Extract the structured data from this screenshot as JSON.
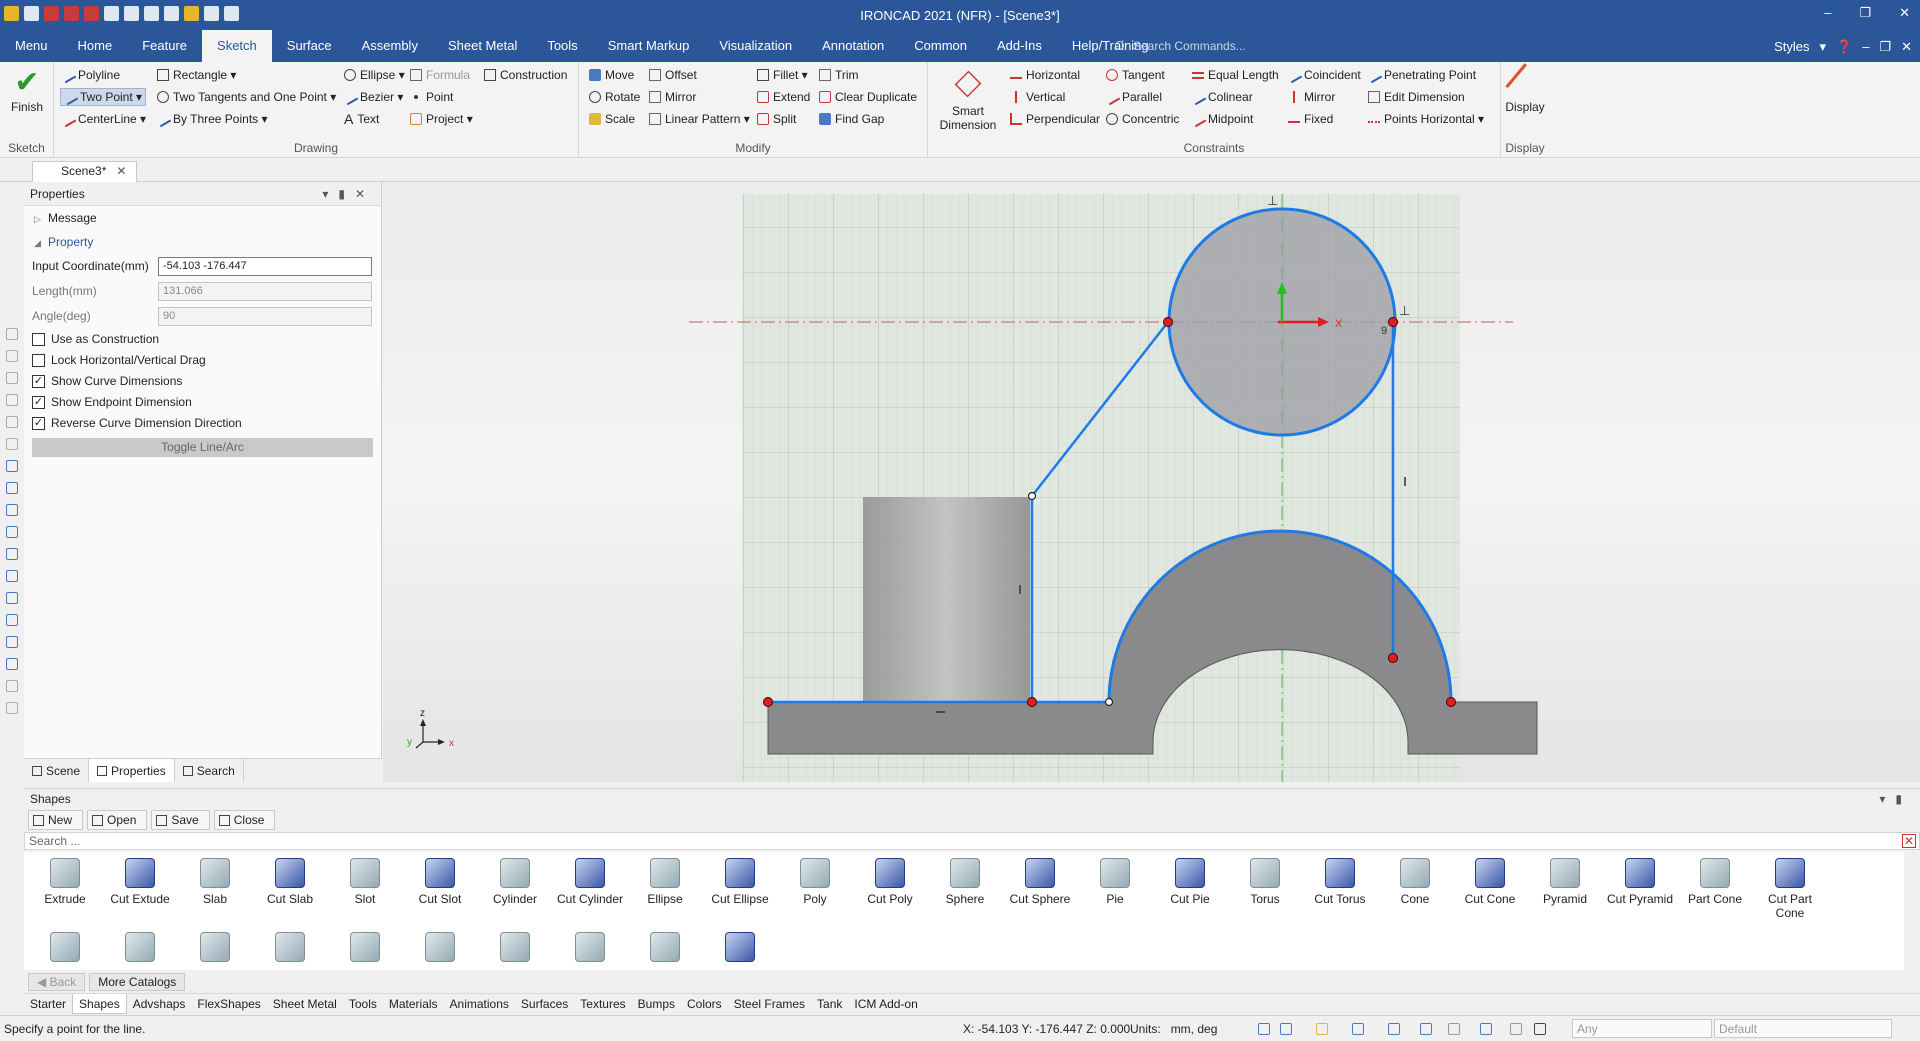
{
  "app": {
    "title": "IRONCAD 2021 (NFR) - [Scene3*]"
  },
  "menu": {
    "tabs": [
      "Menu",
      "Home",
      "Feature",
      "Sketch",
      "Surface",
      "Assembly",
      "Sheet Metal",
      "Tools",
      "Smart Markup",
      "Visualization",
      "Annotation",
      "Common",
      "Add-Ins",
      "Help/Training"
    ],
    "active_tab": "Sketch",
    "search_placeholder": "Search Commands...",
    "styles_label": "Styles"
  },
  "ribbon": {
    "finish_label": "Finish",
    "sketch_group": "Sketch",
    "drawing": {
      "label": "Drawing",
      "polyline": "Polyline",
      "two_point": "Two Point",
      "centerline": "CenterLine",
      "rectangle": "Rectangle",
      "two_tangents": "Two Tangents and One Point",
      "by_three_points": "By Three Points",
      "ellipse": "Ellipse",
      "bezier": "Bezier",
      "text": "Text",
      "formula": "Formula",
      "point": "Point",
      "project": "Project",
      "construction": "Construction"
    },
    "modify": {
      "label": "Modify",
      "move": "Move",
      "rotate": "Rotate",
      "scale": "Scale",
      "offset": "Offset",
      "mirror": "Mirror",
      "linear_pattern": "Linear Pattern",
      "fillet": "Fillet",
      "extend": "Extend",
      "split": "Split",
      "trim": "Trim",
      "clear_duplicate": "Clear Duplicate",
      "find_gap": "Find Gap"
    },
    "smart_dimension": "Smart Dimension",
    "constraints": {
      "label": "Constraints",
      "horizontal": "Horizontal",
      "vertical": "Vertical",
      "perpendicular": "Perpendicular",
      "tangent": "Tangent",
      "parallel": "Parallel",
      "concentric": "Concentric",
      "equal_length": "Equal Length",
      "colinear": "Colinear",
      "midpoint": "Midpoint",
      "coincident": "Coincident",
      "mirror": "Mirror",
      "fixed": "Fixed",
      "penetrating_point": "Penetrating Point",
      "edit_dimension": "Edit Dimension",
      "points_horizontal": "Points Horizontal"
    },
    "display": {
      "label": "Display",
      "button": "Display"
    }
  },
  "doc_tab": "Scene3*",
  "properties": {
    "title": "Properties",
    "message_section": "Message",
    "property_section": "Property",
    "input_coordinate_label": "Input Coordinate(mm)",
    "input_coordinate_value": "-54.103 -176.447",
    "length_label": "Length(mm)",
    "length_value": "131.066",
    "angle_label": "Angle(deg)",
    "angle_value": "90",
    "checkboxes": [
      {
        "label": "Use as Construction",
        "checked": false
      },
      {
        "label": "Lock Horizontal/Vertical Drag",
        "checked": false
      },
      {
        "label": "Show Curve Dimensions",
        "checked": true
      },
      {
        "label": "Show Endpoint Dimension",
        "checked": true
      },
      {
        "label": "Reverse Curve Dimension Direction",
        "checked": true
      }
    ],
    "toggle_button": "Toggle Line/Arc",
    "tabs": [
      "Scene",
      "Properties",
      "Search"
    ]
  },
  "viewport": {
    "axis_x": "X",
    "triad_x": "x",
    "triad_y": "y",
    "triad_z": "z",
    "dim_9": "9"
  },
  "shapes": {
    "title": "Shapes",
    "toolbar": [
      "New",
      "Open",
      "Save",
      "Close"
    ],
    "search_placeholder": "Search ...",
    "items": [
      "Extrude",
      "Cut Extude",
      "Slab",
      "Cut Slab",
      "Slot",
      "Cut Slot",
      "Cylinder",
      "Cut Cylinder",
      "Ellipse",
      "Cut Ellipse",
      "Poly",
      "Cut Poly",
      "Sphere",
      "Cut Sphere",
      "Pie",
      "Cut Pie",
      "Torus",
      "Cut Torus",
      "Cone",
      "Cut Cone",
      "Pyramid",
      "Cut Pyramid",
      "Part Cone",
      "Cut Part Cone"
    ],
    "back_label": "Back",
    "more_catalogs": "More Catalogs",
    "catalog_tabs": [
      "Starter",
      "Shapes",
      "Advshaps",
      "FlexShapes",
      "Sheet Metal",
      "Tools",
      "Materials",
      "Animations",
      "Surfaces",
      "Textures",
      "Bumps",
      "Colors",
      "Steel Frames",
      "Tank",
      "ICM Add-on"
    ],
    "active_catalog": "Shapes"
  },
  "status": {
    "message": "Specify a point for the line.",
    "coords": "X: -54.103 Y: -176.447 Z: 0.000",
    "units_label": "Units:",
    "units_value": "mm, deg",
    "filter_any": "Any",
    "filter_default": "Default"
  }
}
